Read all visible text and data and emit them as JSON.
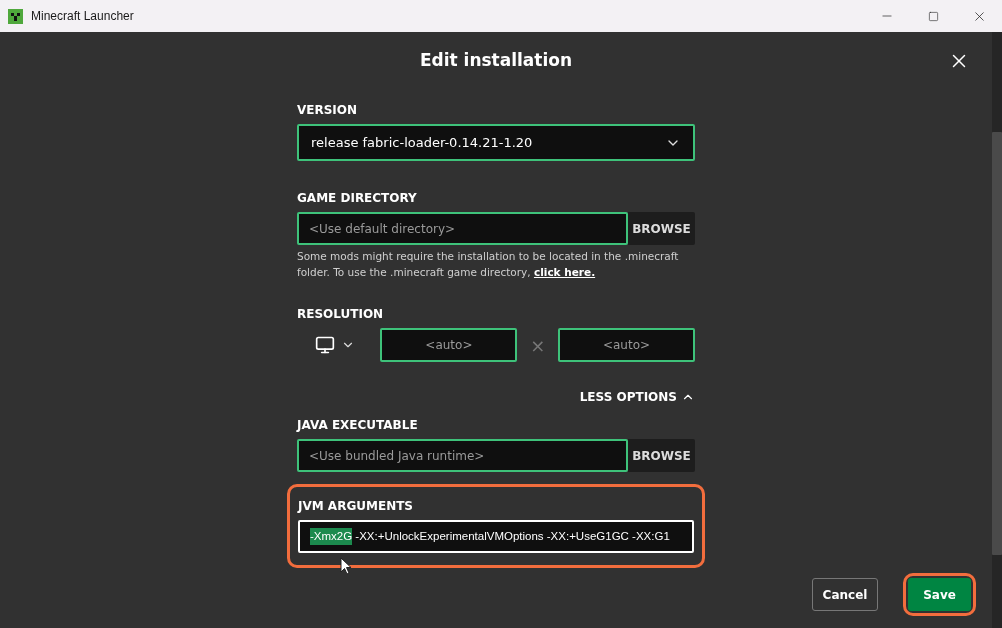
{
  "window": {
    "title": "Minecraft Launcher"
  },
  "dialog": {
    "title": "Edit installation"
  },
  "version": {
    "label": "VERSION",
    "value": "release fabric-loader-0.14.21-1.20"
  },
  "game_directory": {
    "label": "GAME DIRECTORY",
    "placeholder": "<Use default directory>",
    "button": "BROWSE",
    "help": "Some mods might require the installation to be located in the .minecraft folder. To use the .minecraft game directory,",
    "link": "click here."
  },
  "resolution": {
    "label": "RESOLUTION",
    "width_placeholder": "<auto>",
    "separator": "×",
    "height_placeholder": "<auto>"
  },
  "options_toggle": {
    "label": "LESS OPTIONS",
    "expanded": true
  },
  "java_executable": {
    "label": "JAVA EXECUTABLE",
    "placeholder": "<Use bundled Java runtime>",
    "button": "BROWSE"
  },
  "jvm_arguments": {
    "label": "JVM ARGUMENTS",
    "selected_text": "-Xmx2G",
    "value": " -XX:+UnlockExperimentalVMOptions -XX:+UseG1GC -XX:G1",
    "focused": true,
    "highlighted": true
  },
  "buttons": [
    {
      "label": "Cancel",
      "kind": "secondary",
      "highlighted": false
    },
    {
      "label": "Save",
      "kind": "primary",
      "highlighted": true
    }
  ]
}
